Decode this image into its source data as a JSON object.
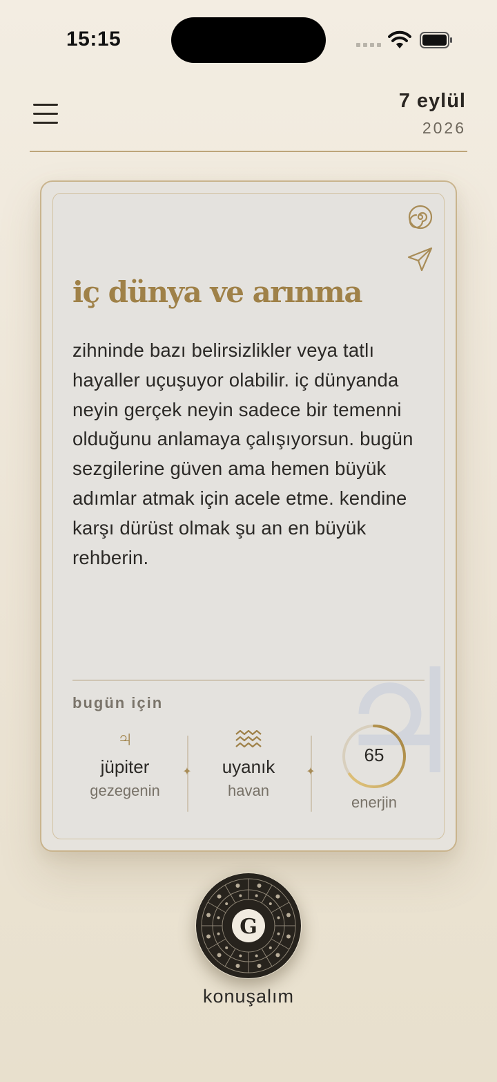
{
  "status_bar": {
    "time": "15:15"
  },
  "header": {
    "date_day": "7 eylül",
    "date_year": "2026"
  },
  "card": {
    "title": "iç dünya ve arınma",
    "body": "zihninde bazı belirsizlikler veya tatlı hayaller uçuşuyor olabilir. iç dünyanda neyin gerçek neyin sadece bir temenni olduğunu anlamaya çalışıyorsun. bugün sezgilerine güven ama hemen büyük adımlar atmak için acele etme. kendine karşı dürüst olmak şu an en büyük rehberin.",
    "today_label": "bugün için",
    "planet": {
      "symbol": "♃",
      "value": "jüpiter",
      "caption": "gezegenin",
      "icon": "jupiter-icon"
    },
    "mood": {
      "symbol": "≋",
      "value": "uyanık",
      "caption": "havan",
      "icon": "aquarius-waves-icon"
    },
    "energy": {
      "value": "65",
      "caption": "enerjin",
      "level_percent": 65
    },
    "separator_glyph": "✦",
    "background_symbol": "♃"
  },
  "chat": {
    "logo_letter": "G",
    "label": "konuşalım"
  },
  "colors": {
    "accent_gold": "#9f8148",
    "background": "#f0e9dc",
    "card": "#e4e2de",
    "dark_button": "#2b2620"
  },
  "icons": {
    "menu": "hamburger-menu-icon",
    "spiral": "spiral-icon",
    "share": "paper-plane-icon"
  }
}
